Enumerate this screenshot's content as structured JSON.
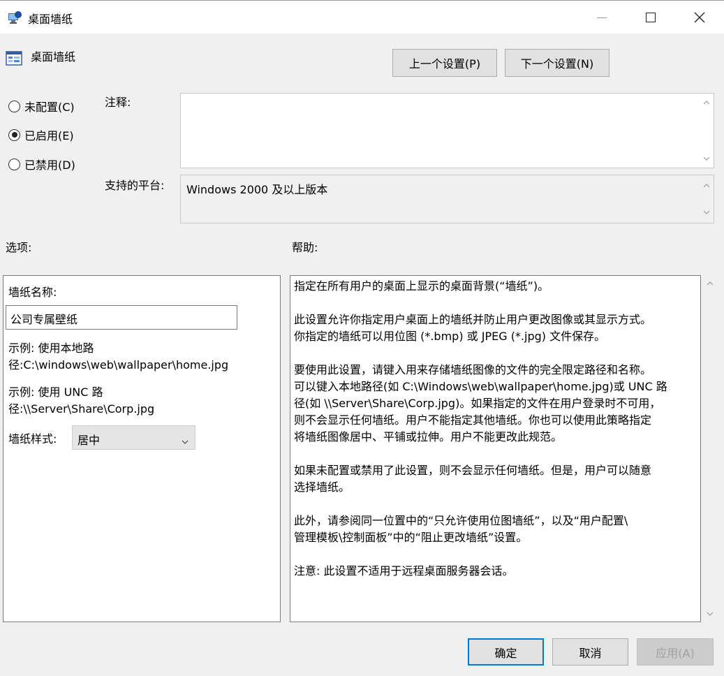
{
  "window": {
    "title": "桌面墙纸",
    "icons": {
      "title": "policy-window-icon",
      "minimize": "minimize-icon",
      "maximize": "maximize-icon",
      "close": "close-icon"
    }
  },
  "policy": {
    "title": "桌面墙纸",
    "icon": "policy-setting-icon"
  },
  "nav": {
    "prev": "上一个设置(P)",
    "next": "下一个设置(N)"
  },
  "state": {
    "options": [
      {
        "label": "未配置(C)",
        "selected": false
      },
      {
        "label": "已启用(E)",
        "selected": true
      },
      {
        "label": "已禁用(D)",
        "selected": false
      }
    ]
  },
  "comment": {
    "label": "注释:",
    "value": ""
  },
  "platform": {
    "label": "支持的平台:",
    "value": "Windows 2000 及以上版本"
  },
  "options_section": {
    "label": "选项:",
    "wallpaper_name_label": "墙纸名称:",
    "wallpaper_name_value": "公司专属壁纸",
    "example1_line1": "示例: 使用本地路",
    "example1_line2": "径:C:\\windows\\web\\wallpaper\\home.jpg",
    "example2_line1": "示例: 使用 UNC 路",
    "example2_line2": "径:\\\\Server\\Share\\Corp.jpg",
    "style_label": "墙纸样式:",
    "style_value": "居中"
  },
  "help": {
    "label": "帮助:",
    "p1": "指定在所有用户的桌面上显示的桌面背景(“墙纸”)。",
    "p2a": "此设置允许你指定用户桌面上的墙纸并防止用户更改图像或其显示方式。",
    "p2b": "你指定的墙纸可以用位图 (*.bmp) 或 JPEG (*.jpg) 文件保存。",
    "p3a": "要使用此设置，请键入用来存储墙纸图像的文件的完全限定路径和名称。",
    "p3b": "可以键入本地路径(如 C:\\Windows\\web\\wallpaper\\home.jpg)或 UNC 路",
    "p3c": "径(如 \\\\Server\\Share\\Corp.jpg)。如果指定的文件在用户登录时不可用，",
    "p3d": "则不会显示任何墙纸。用户不能指定其他墙纸。你也可以使用此策略指定",
    "p3e": "将墙纸图像居中、平铺或拉伸。用户不能更改此规范。",
    "p4a": "如果未配置或禁用了此设置，则不会显示任何墙纸。但是，用户可以随意",
    "p4b": "选择墙纸。",
    "p5a": "此外，请参阅同一位置中的“只允许使用位图墙纸”，以及“用户配置\\",
    "p5b": "管理模板\\控制面板”中的“阻止更改墙纸”设置。",
    "p6": "注意: 此设置不适用于远程桌面服务器会话。"
  },
  "buttons": {
    "ok": "确定",
    "cancel": "取消",
    "apply": "应用(A)"
  },
  "colors": {
    "accent": "#0078d7",
    "window_bg": "#f0f0f0",
    "disabled_text": "#a0a0a0"
  }
}
